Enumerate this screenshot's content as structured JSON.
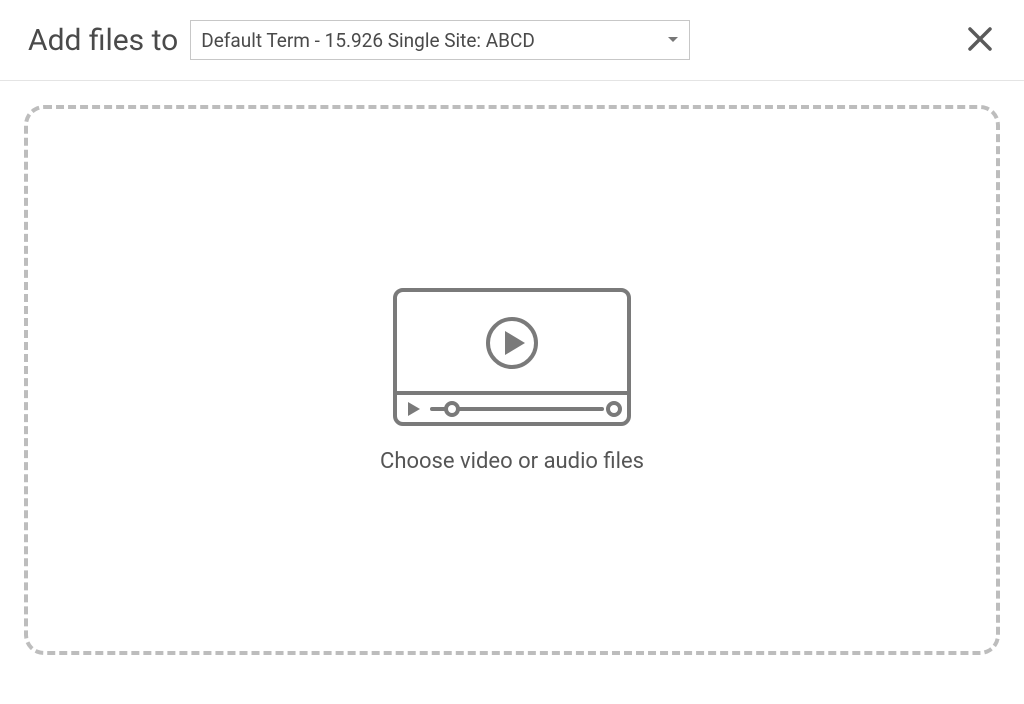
{
  "header": {
    "title": "Add files to",
    "select": {
      "value": "Default Term - 15.926 Single Site: ABCD"
    }
  },
  "dropzone": {
    "label": "Choose video or audio files"
  }
}
